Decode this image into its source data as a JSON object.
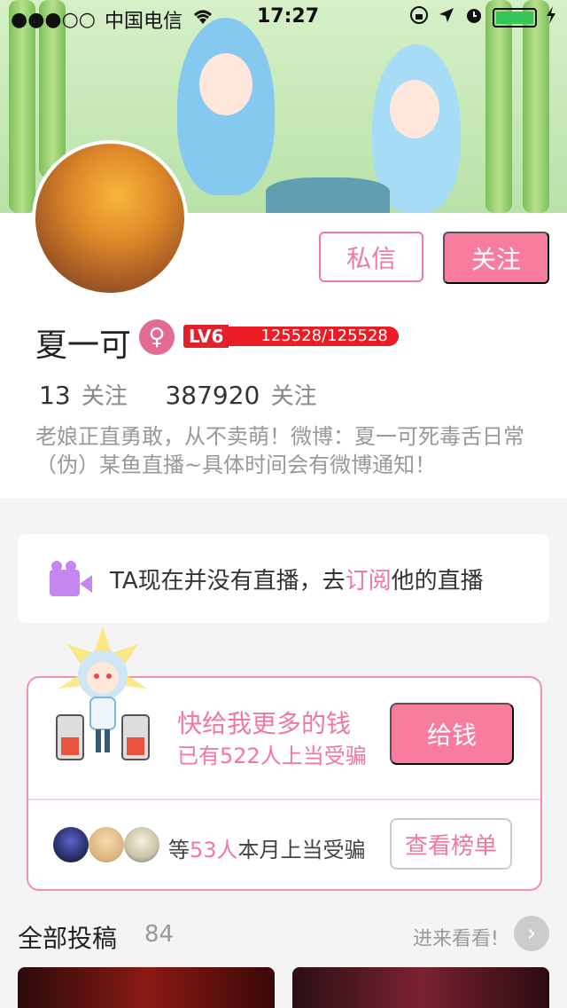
{
  "status_bar": {
    "signal": "●●●○○",
    "carrier": "中国电信",
    "time": "17:27"
  },
  "profile": {
    "name": "夏一可",
    "gender_symbol": "♀",
    "level_tag": "LV6",
    "level_progress": "125528/125528",
    "following_count": "13",
    "following_label": "关注",
    "followers_count": "387920",
    "followers_label": "关注",
    "bio": "老娘正直勇敢，从不卖萌！微博：夏一可死毒舌日常（伪）某鱼直播~具体时间会有微博通知！",
    "message_button": "私信",
    "follow_button": "关注"
  },
  "live": {
    "text_before": "TA现在并没有直播，去",
    "link": "订阅",
    "text_after": "他的直播"
  },
  "donation": {
    "title": "快给我更多的钱",
    "subtitle": "已有522人上当受骗",
    "give_button": "给钱",
    "supporters_prefix": "等",
    "supporters_count": "53人",
    "supporters_suffix": "本月上当受骗",
    "rank_button": "查看榜单"
  },
  "submissions": {
    "title": "全部投稿",
    "count": "84",
    "more": "进来看看!",
    "more_icon": "›"
  },
  "colors": {
    "accent": "#f77c9e",
    "accent_text": "#f0799c",
    "level_red": "#e3202d",
    "battery_green": "#35c759"
  }
}
